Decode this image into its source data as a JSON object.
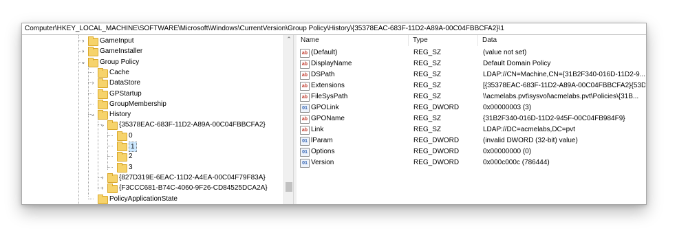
{
  "address": "Computer\\HKEY_LOCAL_MACHINE\\SOFTWARE\\Microsoft\\Windows\\CurrentVersion\\Group Policy\\History\\{35378EAC-683F-11D2-A89A-00C04FBBCFA2}\\1",
  "tree": [
    {
      "label": "GameInput",
      "chev": "›"
    },
    {
      "label": "GameInstaller",
      "chev": "›"
    },
    {
      "label": "Group Policy",
      "chev": "⌄"
    },
    {
      "label": "Cache",
      "chev": ""
    },
    {
      "label": "DataStore",
      "chev": "›"
    },
    {
      "label": "GPStartup",
      "chev": ""
    },
    {
      "label": "GroupMembership",
      "chev": ""
    },
    {
      "label": "History",
      "chev": "⌄"
    },
    {
      "label": "{35378EAC-683F-11D2-A89A-00C04FBBCFA2}",
      "chev": "⌄"
    },
    {
      "label": "0",
      "chev": ""
    },
    {
      "label": "1",
      "chev": ""
    },
    {
      "label": "2",
      "chev": ""
    },
    {
      "label": "3",
      "chev": ""
    },
    {
      "label": "{827D319E-6EAC-11D2-A4EA-00C04F79F83A}",
      "chev": "›"
    },
    {
      "label": "{F3CCC681-B74C-4060-9F26-CD84525DCA2A}",
      "chev": "›"
    },
    {
      "label": "PolicyApplicationState",
      "chev": ""
    }
  ],
  "columns": {
    "name": "Name",
    "type": "Type",
    "data": "Data"
  },
  "values": [
    {
      "icon": "ab",
      "kind": "string-value-icon",
      "name": "(Default)",
      "type": "REG_SZ",
      "data": "(value not set)"
    },
    {
      "icon": "ab",
      "kind": "string-value-icon",
      "name": "DisplayName",
      "type": "REG_SZ",
      "data": "Default Domain Policy"
    },
    {
      "icon": "ab",
      "kind": "string-value-icon",
      "name": "DSPath",
      "type": "REG_SZ",
      "data": "LDAP://CN=Machine,CN={31B2F340-016D-11D2-9..."
    },
    {
      "icon": "ab",
      "kind": "string-value-icon",
      "name": "Extensions",
      "type": "REG_SZ",
      "data": "[{35378EAC-683F-11D2-A89A-00C04FBBCFA2}{53D..."
    },
    {
      "icon": "ab",
      "kind": "string-value-icon",
      "name": "FileSysPath",
      "type": "REG_SZ",
      "data": "\\\\acmelabs.pvt\\sysvol\\acmelabs.pvt\\Policies\\{31B..."
    },
    {
      "icon": "01",
      "kind": "dword-value-icon",
      "name": "GPOLink",
      "type": "REG_DWORD",
      "data": "0x00000003 (3)"
    },
    {
      "icon": "ab",
      "kind": "string-value-icon",
      "name": "GPOName",
      "type": "REG_SZ",
      "data": "{31B2F340-016D-11D2-945F-00C04FB984F9}"
    },
    {
      "icon": "ab",
      "kind": "string-value-icon",
      "name": "Link",
      "type": "REG_SZ",
      "data": "LDAP://DC=acmelabs,DC=pvt"
    },
    {
      "icon": "01",
      "kind": "dword-value-icon",
      "name": "lParam",
      "type": "REG_DWORD",
      "data": "(invalid DWORD (32-bit) value)"
    },
    {
      "icon": "01",
      "kind": "dword-value-icon",
      "name": "Options",
      "type": "REG_DWORD",
      "data": "0x00000000 (0)"
    },
    {
      "icon": "01",
      "kind": "dword-value-icon",
      "name": "Version",
      "type": "REG_DWORD",
      "data": "0x000c000c (786444)"
    }
  ],
  "colors": {
    "selection": "#cce8ff",
    "folder": "#f6d36b"
  }
}
